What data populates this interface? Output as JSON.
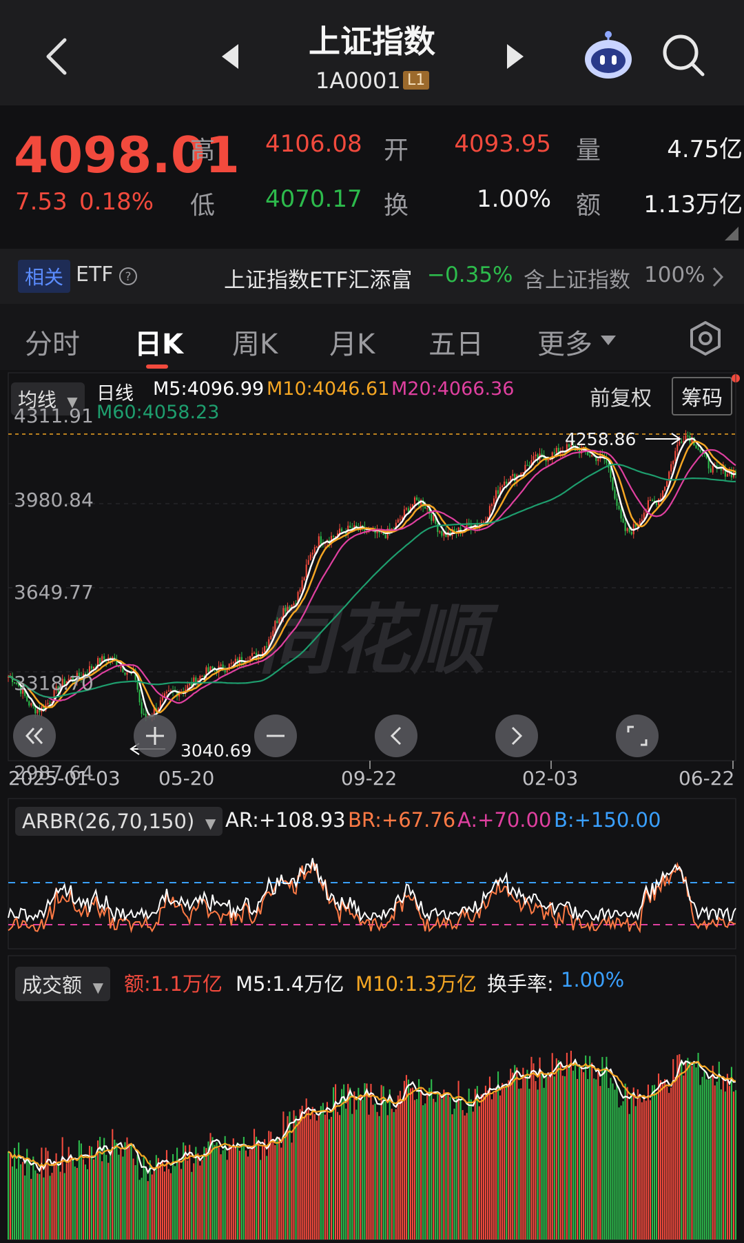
{
  "header": {
    "title": "上证指数",
    "code": "1A0001",
    "level_badge": "L1"
  },
  "quote": {
    "price": "4098.01",
    "change": "7.53",
    "change_pct": "0.18%",
    "high_label": "高",
    "high": "4106.08",
    "low_label": "低",
    "low": "4070.17",
    "open_label": "开",
    "open": "4093.95",
    "turnover_label": "换",
    "turnover": "1.00%",
    "volume_label": "量",
    "volume": "4.75亿",
    "amount_label": "额",
    "amount": "1.13万亿"
  },
  "etf": {
    "badge": "相关",
    "label": "ETF",
    "name": "上证指数ETF汇添富",
    "change": "−0.35%",
    "holding_label": "含上证指数",
    "holding_pct": "100%"
  },
  "tabs": [
    {
      "label": "分时"
    },
    {
      "label": "日K"
    },
    {
      "label": "周K"
    },
    {
      "label": "月K"
    },
    {
      "label": "五日"
    },
    {
      "label": "更多"
    }
  ],
  "kline": {
    "ma_select": "均线",
    "period": "日线",
    "m5": "M5:4096.99",
    "m10": "M10:4046.61",
    "m20": "M20:4066.36",
    "m60": "M60:4058.23",
    "adjust": "前复权",
    "chip": "筹码",
    "y_labels": [
      "4311.91",
      "3980.84",
      "3649.77",
      "3318.70",
      "2987.64"
    ],
    "high_mark": "4258.86",
    "low_mark": "3040.69",
    "x_labels": [
      "2025-01-03",
      "05-20",
      "09-22",
      "02-03",
      "06-22"
    ]
  },
  "arbr": {
    "select": "ARBR(26,70,150)",
    "ar": "AR:+108.93",
    "br": "BR:+67.76",
    "a": "A:+70.00",
    "b": "B:+150.00"
  },
  "volume": {
    "select": "成交额",
    "amount": "额:1.1万亿",
    "m5": "M5:1.4万亿",
    "m10": "M10:1.3万亿",
    "turnover_label": "换手率:",
    "turnover": "1.00%"
  },
  "colors": {
    "up": "#f24a3d",
    "down": "#2dbb4c",
    "m5": "#ffffff",
    "m10": "#f5a623",
    "m20": "#e040a0",
    "m60": "#1e9e6e",
    "b_line": "#3aa0ff"
  },
  "icons": [
    "back-icon",
    "prev-stock-icon",
    "next-stock-icon",
    "robot-icon",
    "search-icon",
    "help-icon",
    "chevron-right-icon",
    "settings-icon",
    "rewind-icon",
    "zoom-in-icon",
    "zoom-out-icon",
    "pan-left-icon",
    "pan-right-icon",
    "fullscreen-icon"
  ]
}
